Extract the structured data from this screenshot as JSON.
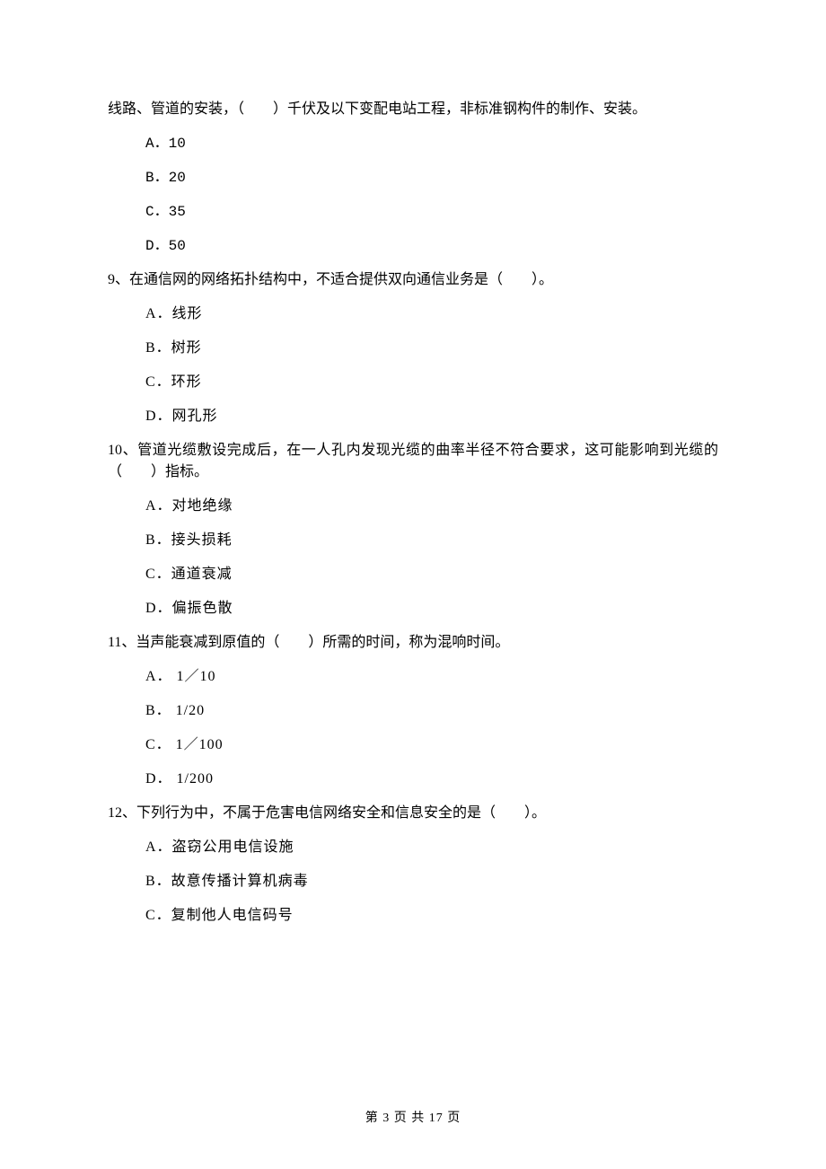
{
  "q8": {
    "stem": "线路、管道的安装，（　　）千伏及以下变配电站工程，非标准钢构件的制作、安装。",
    "options": {
      "A": "A．10",
      "B": "B．20",
      "C": "C．35",
      "D": "D．50"
    }
  },
  "q9": {
    "stem": "9、在通信网的网络拓扑结构中，不适合提供双向通信业务是（　　）。",
    "options": {
      "A": "A．线形",
      "B": "B．树形",
      "C": "C．环形",
      "D": "D．网孔形"
    }
  },
  "q10": {
    "stem": "10、管道光缆敷设完成后，在一人孔内发现光缆的曲率半径不符合要求，这可能影响到光缆的（　　）指标。",
    "options": {
      "A": "A．对地绝缘",
      "B": "B．接头损耗",
      "C": "C．通道衰减",
      "D": "D．偏振色散"
    }
  },
  "q11": {
    "stem": "11、当声能衰减到原值的（　　）所需的时间，称为混响时间。",
    "options": {
      "A": "A．  1／10",
      "B": "B．  1/20",
      "C": "C．  1／100",
      "D": "D．  1/200"
    }
  },
  "q12": {
    "stem": "12、下列行为中，不属于危害电信网络安全和信息安全的是（　　）。",
    "options": {
      "A": "A．盗窃公用电信设施",
      "B": "B．故意传播计算机病毒",
      "C": "C．复制他人电信码号"
    }
  },
  "footer": "第 3 页 共 17 页"
}
